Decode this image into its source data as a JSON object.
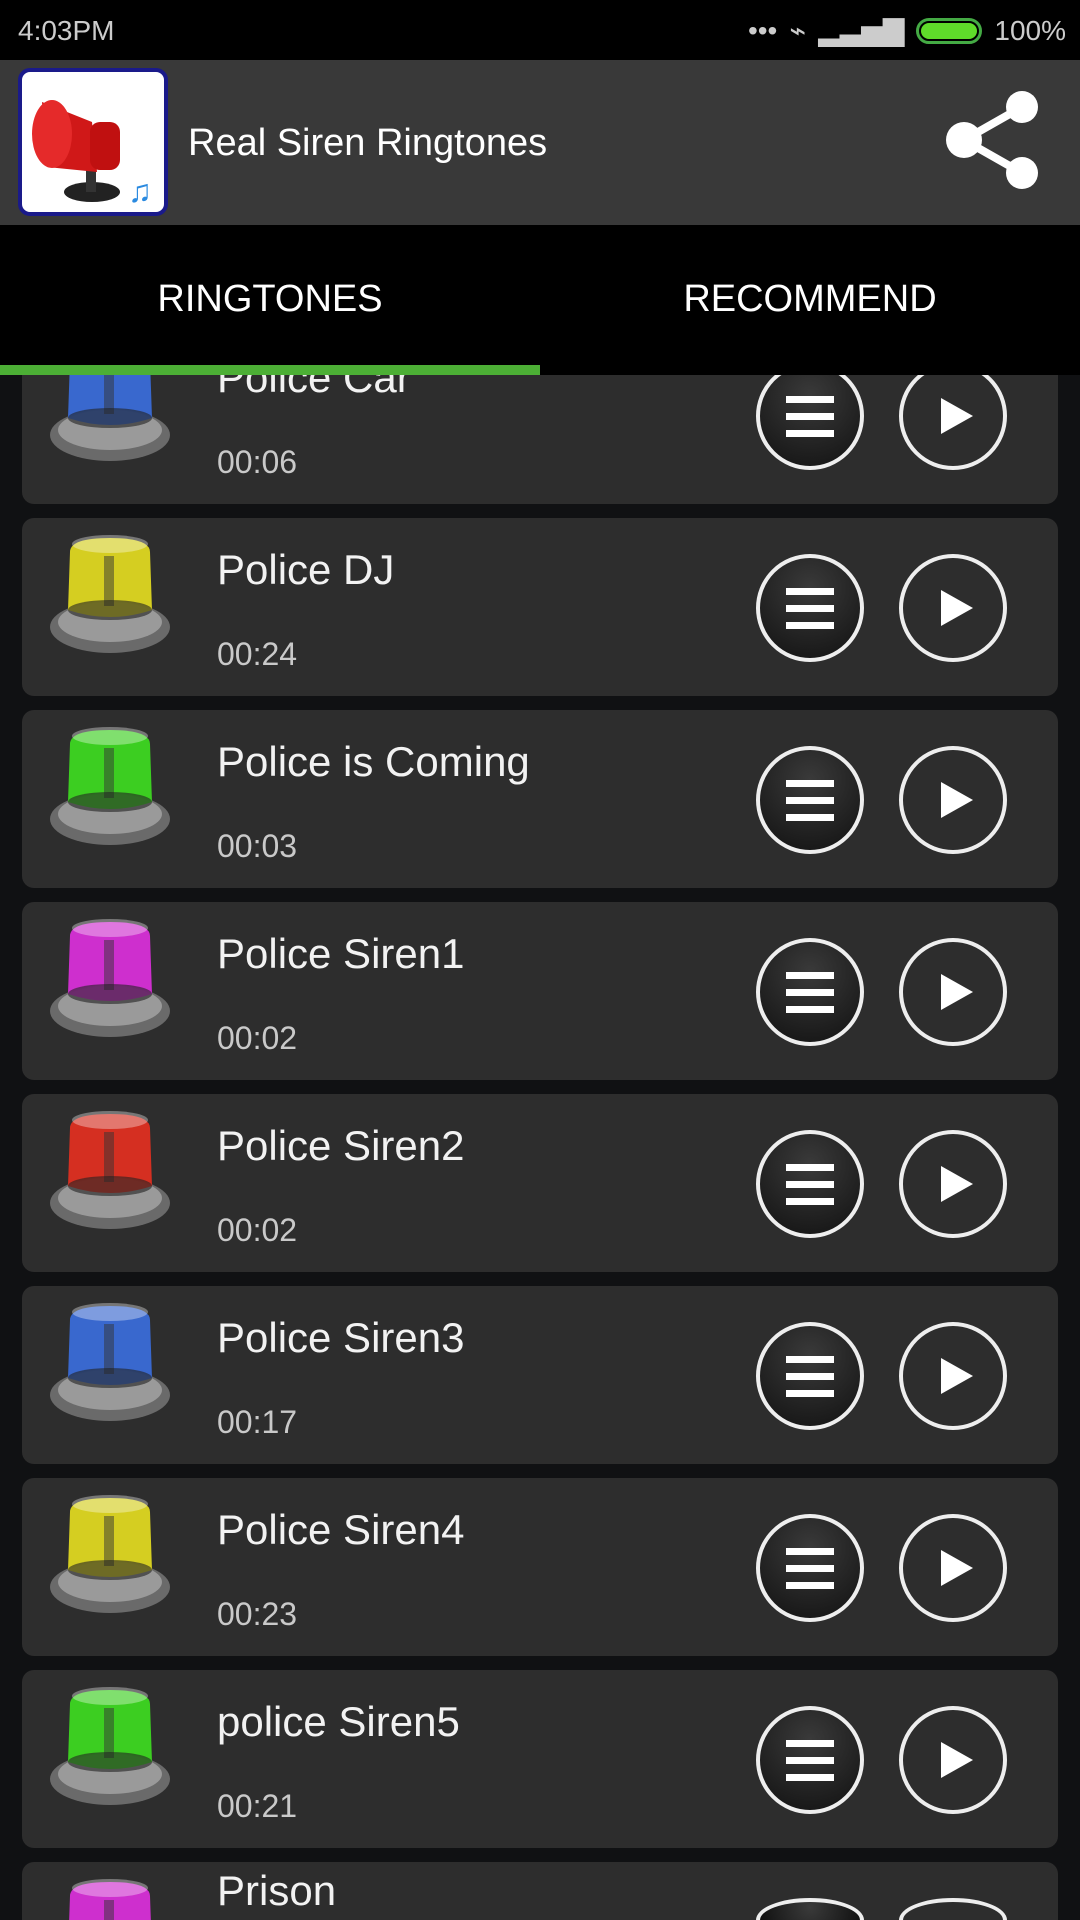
{
  "status_bar": {
    "time": "4:03PM",
    "battery": "100%",
    "battery_level": 100
  },
  "header": {
    "title": "Real Siren Ringtones",
    "share_icon": "share-icon"
  },
  "tabs": [
    {
      "label": "RINGTONES",
      "active": true
    },
    {
      "label": "RECOMMEND",
      "active": false
    }
  ],
  "accent_color": "#4caf35",
  "ringtones": [
    {
      "name": "Police Car",
      "duration": "00:06",
      "color": "#3b6fe0"
    },
    {
      "name": "Police DJ",
      "duration": "00:24",
      "color": "#e8e020"
    },
    {
      "name": "Police is Coming",
      "duration": "00:03",
      "color": "#3ee020"
    },
    {
      "name": "Police Siren1",
      "duration": "00:02",
      "color": "#e030e0"
    },
    {
      "name": "Police Siren2",
      "duration": "00:02",
      "color": "#e83020"
    },
    {
      "name": "Police Siren3",
      "duration": "00:17",
      "color": "#3b6fe0"
    },
    {
      "name": "Police Siren4",
      "duration": "00:23",
      "color": "#e8e020"
    },
    {
      "name": "police Siren5",
      "duration": "00:21",
      "color": "#3ee020"
    },
    {
      "name": "Prison",
      "color": "#e030e0"
    }
  ]
}
